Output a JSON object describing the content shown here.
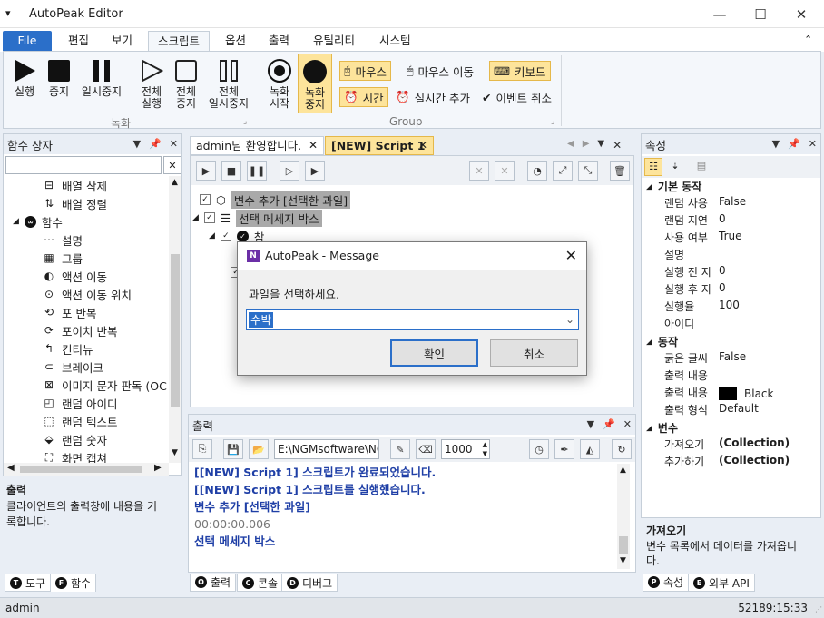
{
  "app": {
    "title": "AutoPeak Editor"
  },
  "window": {
    "minimize": "—",
    "maximize": "☐",
    "close": "✕"
  },
  "ribbon_tabs": [
    "File",
    "편집",
    "보기",
    "스크립트",
    "옵션",
    "출력",
    "유틸리티",
    "시스템"
  ],
  "ribbon": {
    "run": "실행",
    "stop": "중지",
    "pause": "일시중지",
    "run_all": [
      "전체",
      "실행"
    ],
    "stop_all": [
      "전체",
      "중지"
    ],
    "pause_all": [
      "전체",
      "일시중지"
    ],
    "rec_start": [
      "녹화",
      "시작"
    ],
    "rec_stop": [
      "녹화",
      "중지"
    ],
    "group_record": "녹화",
    "group_group": "Group",
    "mouse": "마우스",
    "mouse_move": "마우스 이동",
    "keyboard": "키보드",
    "time": "시간",
    "realtime_add": "실시간 추가",
    "cancel_event": "이벤트 취소"
  },
  "func_panel": {
    "title": "함수 상자",
    "items": [
      "배열 삭제",
      "배열 정렬",
      "함수",
      "설명",
      "그룹",
      "액션 이동",
      "액션 이동 위치",
      "포 반복",
      "포이치 반복",
      "컨티뉴",
      "브레이크",
      "이미지 문자 판독 (OC",
      "랜덤 아이디",
      "랜덤 텍스트",
      "랜덤 숫자",
      "화면 캡쳐"
    ],
    "desc_title": "출력",
    "desc_text": [
      "클라이언트의 출력창에 내용을 기",
      "록합니다."
    ],
    "tabs": [
      "도구",
      "함수"
    ]
  },
  "doc_tabs": [
    "admin님 환영합니다.",
    "[NEW] Script 1"
  ],
  "script_tree": [
    "변수 추가 [선택한 과일]",
    "선택 메세지 박스",
    "참"
  ],
  "output": {
    "title": "출력",
    "path": "E:\\NGMsoftware\\NG",
    "number": "1000",
    "lines": [
      "[[NEW] Script 1] 스크립트가 완료되었습니다.",
      "[[NEW] Script 1] 스크립트를 실행했습니다.",
      "변수 추가 [선택한 과일]",
      "00:00:00.006",
      "선택 메세지 박스"
    ],
    "tabs": [
      "출력",
      "콘솔",
      "디버그"
    ]
  },
  "props": {
    "title": "속성",
    "cat1": "기본 동작",
    "rows1": [
      [
        "랜덤 사용",
        "False"
      ],
      [
        "랜덤 지연",
        "0"
      ],
      [
        "사용 여부",
        "True"
      ],
      [
        "설명",
        ""
      ],
      [
        "실행 전 지",
        "0"
      ],
      [
        "실행 후 지",
        "0"
      ],
      [
        "실행율",
        "100"
      ],
      [
        "아이디",
        ""
      ]
    ],
    "cat2": "동작",
    "rows2": [
      [
        "굵은 글씨",
        "False"
      ],
      [
        "출력 내용",
        ""
      ],
      [
        "출력 내용",
        "Black"
      ],
      [
        "출력 형식",
        "Default"
      ]
    ],
    "cat3": "변수",
    "rows3": [
      [
        "가져오기",
        "(Collection)"
      ],
      [
        "추가하기",
        "(Collection)"
      ]
    ],
    "desc_title": "가져오기",
    "desc_text": [
      "변수 목록에서 데이터를 가져옵니",
      "다."
    ],
    "tabs": [
      "속성",
      "외부 API"
    ]
  },
  "dialog": {
    "title": "AutoPeak - Message",
    "message": "과일을 선택하세요.",
    "value": "수박",
    "ok": "확인",
    "cancel": "취소"
  },
  "status": {
    "user": "admin",
    "clock": "52189:15:33"
  },
  "colors": {
    "file_tab": "#2b6fc9",
    "highlight": "#fde49b",
    "output_text": "#1f3fa6"
  }
}
